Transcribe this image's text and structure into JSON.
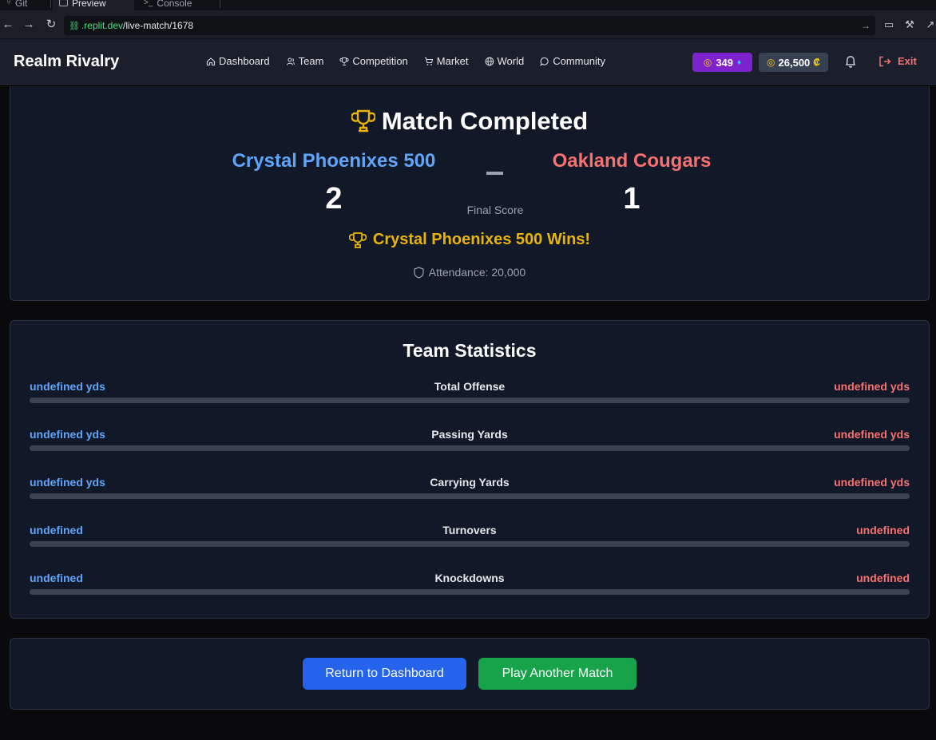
{
  "browser": {
    "tabs": [
      {
        "label": "Git"
      },
      {
        "label": "Preview"
      },
      {
        "label": "Console"
      }
    ],
    "url_domain": ".replit.dev",
    "url_path": "/live-match/1678"
  },
  "header": {
    "brand": "Realm Rivalry",
    "nav": [
      {
        "label": "Dashboard",
        "icon": "home-icon"
      },
      {
        "label": "Team",
        "icon": "users-icon"
      },
      {
        "label": "Competition",
        "icon": "trophy-icon"
      },
      {
        "label": "Market",
        "icon": "cart-icon"
      },
      {
        "label": "World",
        "icon": "globe-icon"
      },
      {
        "label": "Community",
        "icon": "chat-icon"
      }
    ],
    "gems": "349",
    "credits": "26,500",
    "credit_symbol": "₡",
    "exit_label": "Exit"
  },
  "result": {
    "title": "Match Completed",
    "home_team": "Crystal Phoenixes 500",
    "away_team": "Oakland Cougars",
    "home_score": "2",
    "away_score": "1",
    "final_label": "Final Score",
    "winner_text": "Crystal Phoenixes 500 Wins!",
    "attendance": "Attendance: 20,000"
  },
  "stats": {
    "title": "Team Statistics",
    "rows": [
      {
        "home": "undefined yds",
        "label": "Total Offense",
        "away": "undefined yds"
      },
      {
        "home": "undefined yds",
        "label": "Passing Yards",
        "away": "undefined yds"
      },
      {
        "home": "undefined yds",
        "label": "Carrying Yards",
        "away": "undefined yds"
      },
      {
        "home": "undefined",
        "label": "Turnovers",
        "away": "undefined"
      },
      {
        "home": "undefined",
        "label": "Knockdowns",
        "away": "undefined"
      }
    ]
  },
  "actions": {
    "return_label": "Return to Dashboard",
    "play_label": "Play Another Match"
  },
  "colors": {
    "home": "#60a5fa",
    "away": "#f87171",
    "gold": "#eab308",
    "gem_badge": "#7e22ce",
    "primary_button": "#2563eb",
    "success_button": "#16a34a"
  }
}
